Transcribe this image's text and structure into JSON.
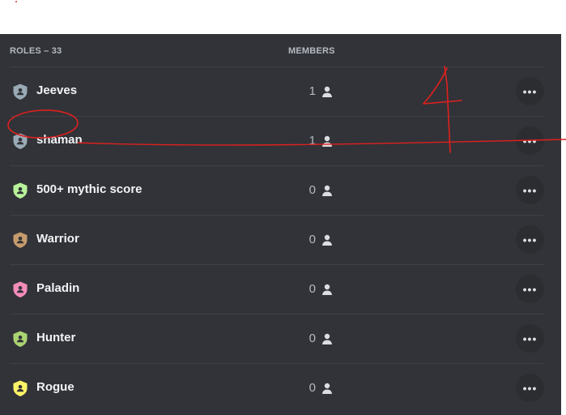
{
  "header": {
    "roles_count": "ROLES – 33",
    "members": "MEMBERS"
  },
  "roles": [
    {
      "name": "Jeeves",
      "members": "1",
      "color": "#99aab5"
    },
    {
      "name": "shaman",
      "members": "1",
      "color": "#99aab5"
    },
    {
      "name": "500+ mythic score",
      "members": "0",
      "color": "#b8f29a"
    },
    {
      "name": "Warrior",
      "members": "0",
      "color": "#c69b6d"
    },
    {
      "name": "Paladin",
      "members": "0",
      "color": "#f48cba"
    },
    {
      "name": "Hunter",
      "members": "0",
      "color": "#aad372"
    },
    {
      "name": "Rogue",
      "members": "0",
      "color": "#fff468"
    }
  ],
  "icons": {
    "role": "shield-person-icon",
    "member": "person-icon",
    "more": "more-options-icon"
  },
  "more_glyph": "•••",
  "annotation_color": "#e0201e"
}
